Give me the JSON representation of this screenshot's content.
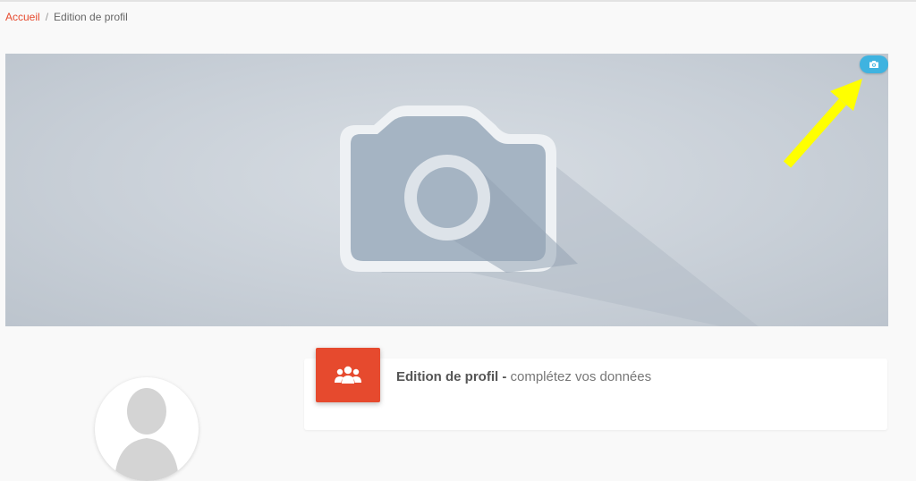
{
  "breadcrumb": {
    "home": "Accueil",
    "separator": "/",
    "current": "Edition de profil"
  },
  "cover": {
    "change_photo_icon": "camera-icon",
    "placeholder_icon": "camera-icon"
  },
  "annotation": {
    "arrow_color": "#ffff00"
  },
  "panel": {
    "icon": "users-group-icon",
    "title": "Edition de profil",
    "separator": " - ",
    "subtitle": "complétez vos données"
  },
  "colors": {
    "accent": "#e64a2e",
    "photo_button": "#3fb3e0"
  }
}
